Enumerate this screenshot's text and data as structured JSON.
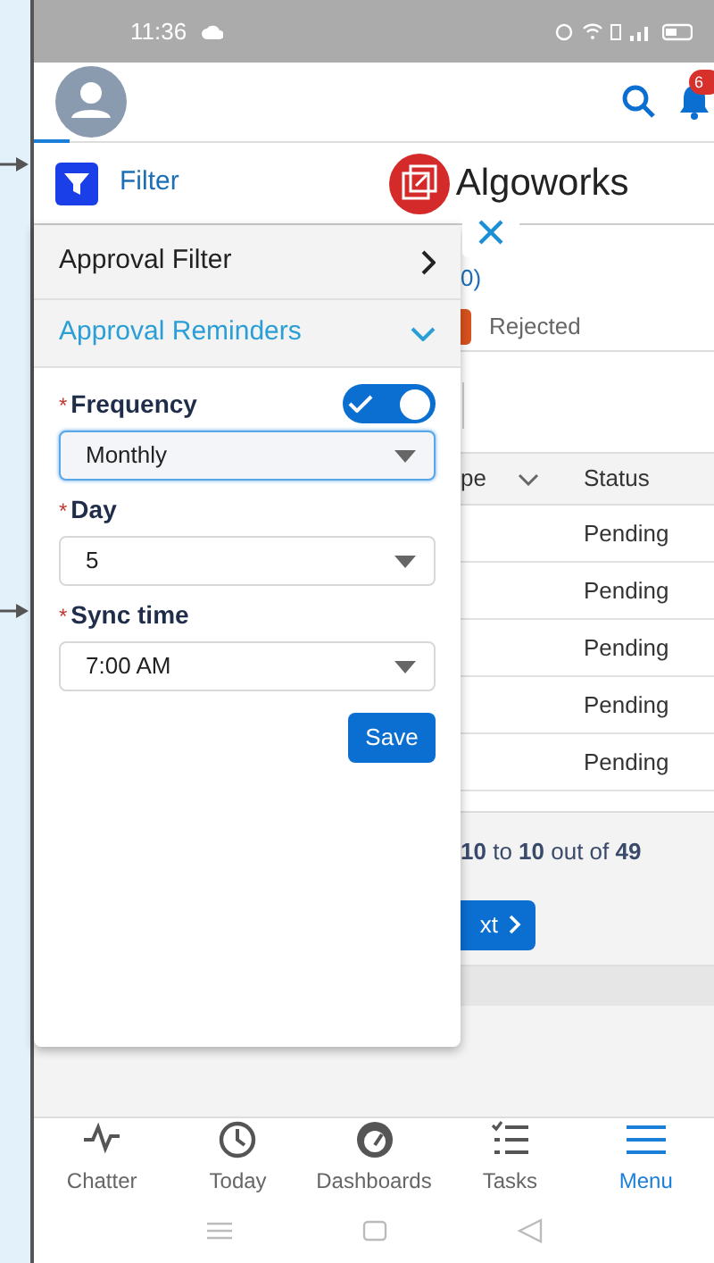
{
  "status_bar": {
    "time": "11:36"
  },
  "header": {
    "notification_count": "6"
  },
  "filter_bar": {
    "label": "Filter",
    "brand": "Algoworks"
  },
  "background": {
    "link_fragment": "0)",
    "status_chip": "Rejected",
    "table": {
      "columns": [
        "pe",
        "Status"
      ],
      "rows": [
        "Pending",
        "Pending",
        "Pending",
        "Pending",
        "Pending"
      ]
    },
    "pagination": "**10** to **10** out of **49**",
    "next_button": "xt"
  },
  "panel": {
    "sections": [
      {
        "title": "Approval Filter",
        "expanded": false
      },
      {
        "title": "Approval Reminders",
        "expanded": true
      }
    ],
    "fields": [
      {
        "label": "Frequency",
        "required_mark": "*",
        "value": "Monthly",
        "focused": true,
        "toggle_on": true
      },
      {
        "label": "Day",
        "required_mark": "*",
        "value": "5",
        "focused": false
      },
      {
        "label": "Sync time",
        "required_mark": "*",
        "value": "7:00 AM",
        "focused": false
      }
    ],
    "save_button": "Save"
  },
  "bottom_nav": [
    {
      "label": "Chatter",
      "kind": "pulse",
      "selected": false
    },
    {
      "label": "Today",
      "kind": "clock",
      "selected": false
    },
    {
      "label": "Dashboards",
      "kind": "gauge",
      "selected": false
    },
    {
      "label": "Tasks",
      "kind": "tasks",
      "selected": false
    },
    {
      "label": "Menu",
      "kind": "menu",
      "selected": true
    }
  ]
}
